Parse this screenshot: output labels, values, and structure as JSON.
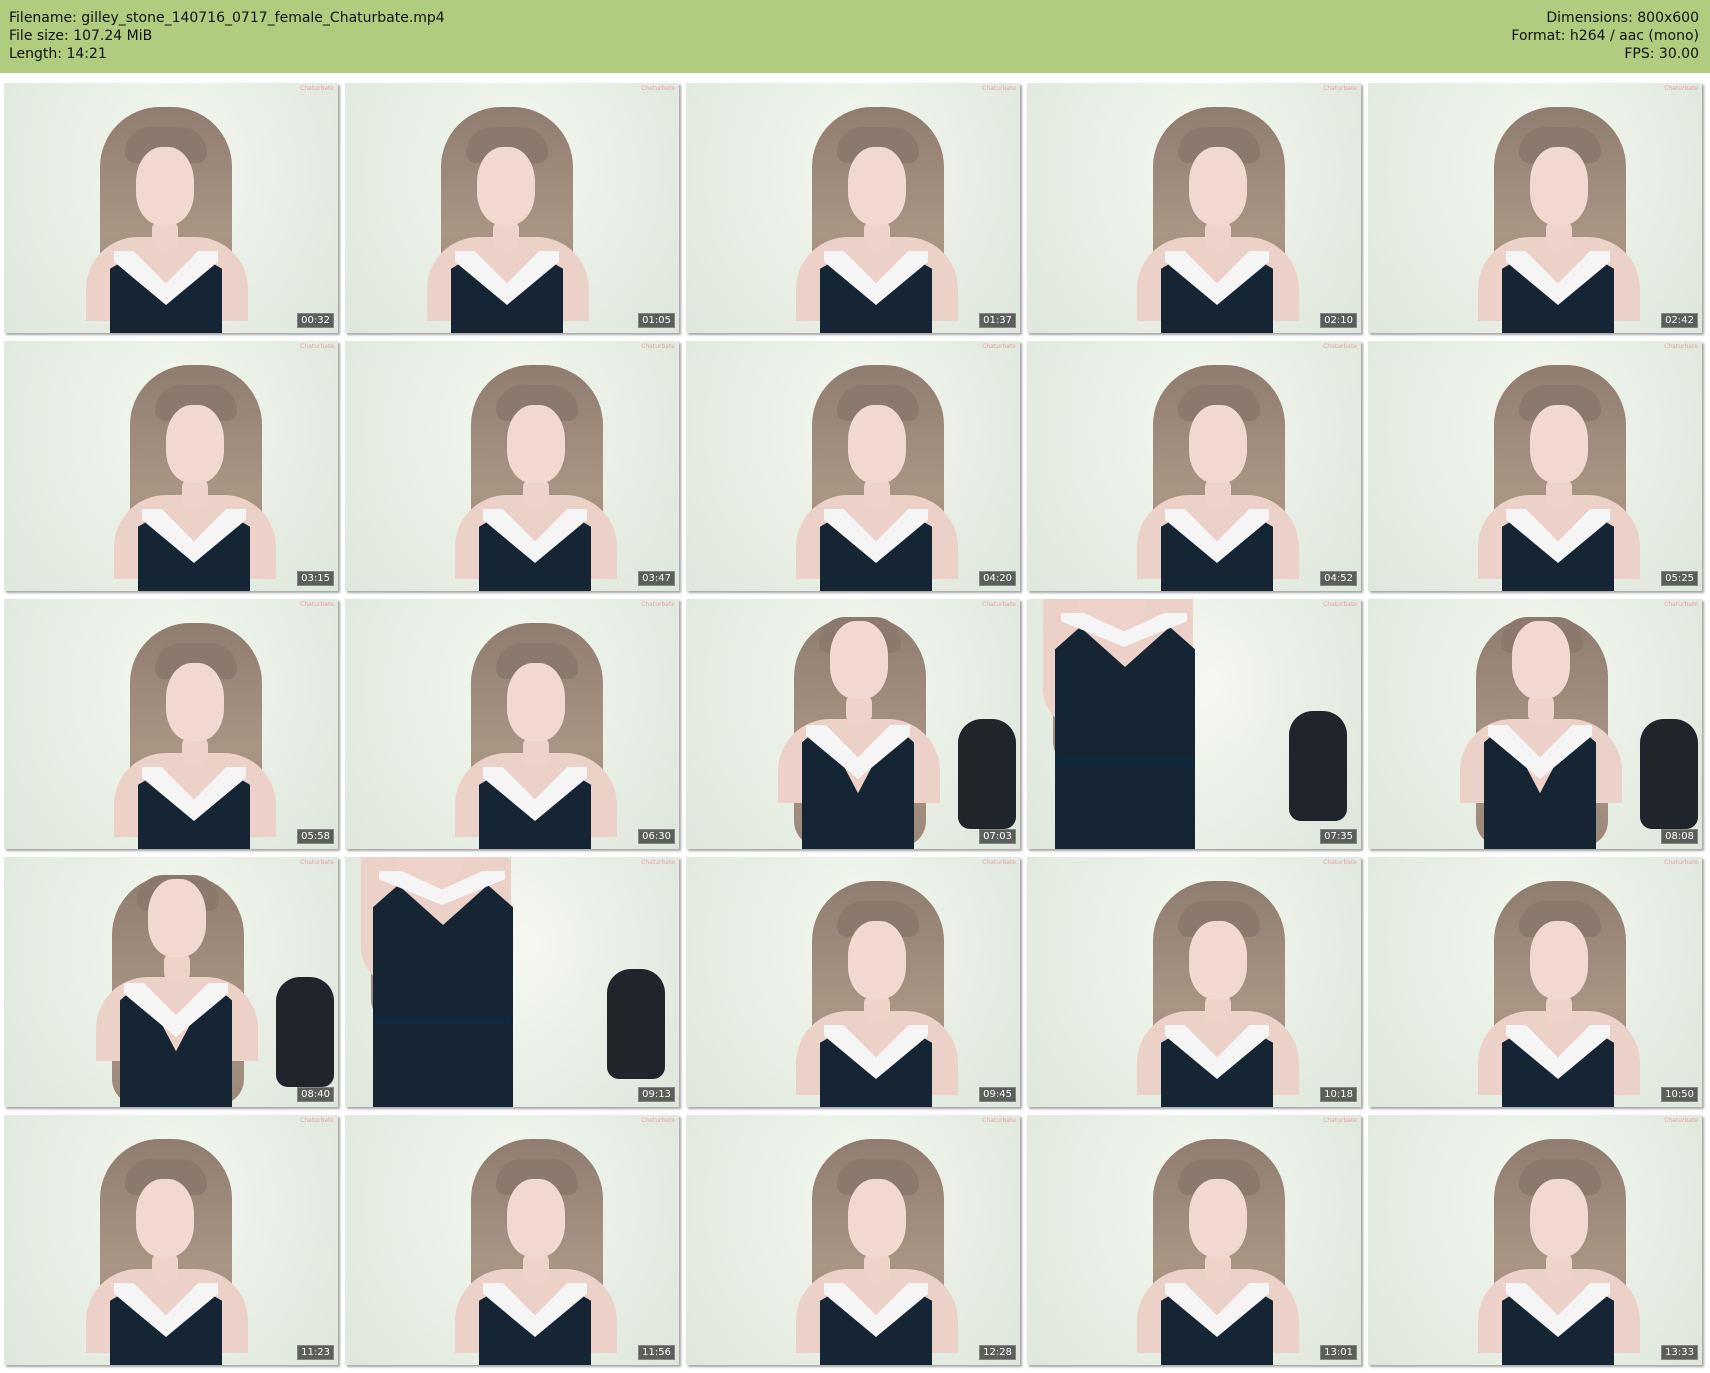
{
  "header": {
    "filename": "Filename: gilley_stone_140716_0717_female_Chaturbate.mp4",
    "filesize": "File size: 107.24 MiB",
    "length": "Length: 14:21",
    "dimensions": "Dimensions: 800x600",
    "format": "Format: h264 / aac (mono)",
    "fps": "FPS: 30.00"
  },
  "thumbnails": [
    {
      "time": "00:32",
      "watermark": "Chaturbate"
    },
    {
      "time": "01:05",
      "watermark": "Chaturbate"
    },
    {
      "time": "01:37",
      "watermark": "Chaturbate"
    },
    {
      "time": "02:10",
      "watermark": "Chaturbate"
    },
    {
      "time": "02:42",
      "watermark": "Chaturbate"
    },
    {
      "time": "03:15",
      "watermark": "Chaturbate"
    },
    {
      "time": "03:47",
      "watermark": "Chaturbate"
    },
    {
      "time": "04:20",
      "watermark": "Chaturbate"
    },
    {
      "time": "04:52",
      "watermark": "Chaturbate"
    },
    {
      "time": "05:25",
      "watermark": "Chaturbate"
    },
    {
      "time": "05:58",
      "watermark": "Chaturbate"
    },
    {
      "time": "06:30",
      "watermark": "Chaturbate"
    },
    {
      "time": "07:03",
      "watermark": "Chaturbate"
    },
    {
      "time": "07:35",
      "watermark": "Chaturbate"
    },
    {
      "time": "08:08",
      "watermark": "Chaturbate"
    },
    {
      "time": "08:40",
      "watermark": "Chaturbate"
    },
    {
      "time": "09:13",
      "watermark": "Chaturbate"
    },
    {
      "time": "09:45",
      "watermark": "Chaturbate"
    },
    {
      "time": "10:18",
      "watermark": "Chaturbate"
    },
    {
      "time": "10:50",
      "watermark": "Chaturbate"
    },
    {
      "time": "11:23",
      "watermark": "Chaturbate"
    },
    {
      "time": "11:56",
      "watermark": "Chaturbate"
    },
    {
      "time": "12:28",
      "watermark": "Chaturbate"
    },
    {
      "time": "13:01",
      "watermark": "Chaturbate"
    },
    {
      "time": "13:33",
      "watermark": "Chaturbate"
    }
  ],
  "colors": {
    "header_background": "#b0cc7e",
    "timestamp_background": "#333333"
  }
}
